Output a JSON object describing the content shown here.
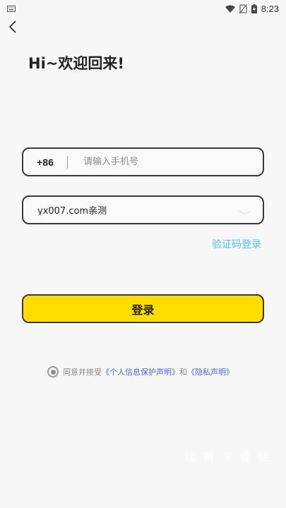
{
  "status_bar": {
    "time": "8:23"
  },
  "header": {
    "title": "Hi~欢迎回来!"
  },
  "phone_field": {
    "country_code": "+86",
    "placeholder": "请输入手机号"
  },
  "password_field": {
    "value": "yx007.com亲测"
  },
  "code_login_link": "验证码登录",
  "login_button": "登录",
  "agreement": {
    "prefix": "同意并接受",
    "user_policy": "《个人信息保护声明》",
    "conjunction": "和",
    "privacy_policy": "《隐私声明》"
  },
  "watermark": "比 司 下 载 站",
  "colors": {
    "accent_yellow": "#ffdd00",
    "link_cyan": "#4fc1e0",
    "link_blue": "#4a6ad0"
  }
}
